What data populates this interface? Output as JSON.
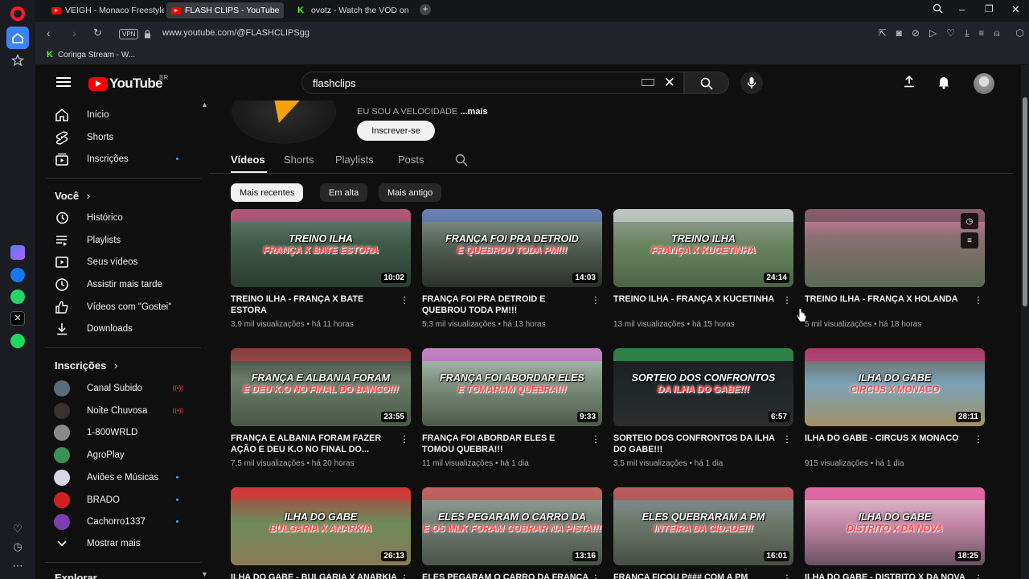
{
  "browser": {
    "tabs": [
      {
        "label": "VEIGH - Monaco Freestyle"
      },
      {
        "label": "FLASH CLIPS - YouTube"
      },
      {
        "label": "ovotz - Watch the VOD on"
      }
    ],
    "url": "www.youtube.com/@FLASHCLIPSgg",
    "vpn_label": "VPN",
    "bookmark": "Coringa Stream - W..."
  },
  "youtube": {
    "logo_text": "YouTube",
    "country_code": "BR",
    "search_value": "flashclips"
  },
  "sidebar": {
    "main": [
      {
        "label": "Início",
        "icon": "home-icon"
      },
      {
        "label": "Shorts",
        "icon": "shorts-icon"
      },
      {
        "label": "Inscrições",
        "icon": "subscriptions-icon"
      }
    ],
    "you_heading": "Você",
    "you": [
      {
        "label": "Histórico",
        "icon": "history-icon"
      },
      {
        "label": "Playlists",
        "icon": "playlists-icon"
      },
      {
        "label": "Seus vídeos",
        "icon": "your-videos-icon"
      },
      {
        "label": "Assistir mais tarde",
        "icon": "watch-later-icon"
      },
      {
        "label": "Vídeos com \"Gostei\"",
        "icon": "liked-icon"
      },
      {
        "label": "Downloads",
        "icon": "download-icon"
      }
    ],
    "subs_heading": "Inscrições",
    "subs": [
      {
        "label": "Canal Subido",
        "color": "#5a6b7a",
        "status": "live"
      },
      {
        "label": "Noite Chuvosa",
        "color": "#3a3030",
        "status": "live"
      },
      {
        "label": "1-800WRLD",
        "color": "#8a8a8a",
        "status": "none"
      },
      {
        "label": "AgroPlay",
        "color": "#3d8f5a",
        "status": "none"
      },
      {
        "label": "Aviões e Músicas",
        "color": "#d7d7e6",
        "status": "dot"
      },
      {
        "label": "BRADO",
        "color": "#d02020",
        "status": "dot"
      },
      {
        "label": "Cachorro1337",
        "color": "#7a3fb0",
        "status": "dot"
      }
    ],
    "show_more": "Mostrar mais",
    "explore": "Explorar"
  },
  "channel": {
    "description": "EU SOU A VELOCIDADE",
    "more": "...mais",
    "subscribe": "Inscrever-se",
    "tabs": [
      "Vídeos",
      "Shorts",
      "Playlists",
      "Posts"
    ],
    "chips": [
      "Mais recentes",
      "Em alta",
      "Mais antigo"
    ]
  },
  "videos": [
    {
      "title": "TREINO ILHA - FRANÇA X BATE ESTORA",
      "meta": "3,9 mil visualizações • há 11 horas",
      "duration": "10:02",
      "overlay": "TREINO ILHA",
      "overlay2": "FRANÇA X BATE ESTORA",
      "bg": "linear-gradient(180deg,#6b7e7a 0%,#3f5a48 45%,#2a3d33 100%)",
      "accent": "#e83a78"
    },
    {
      "title": "FRANÇA FOI PRA DETROID E QUEBROU TODA PM!!!",
      "meta": "5,3 mil visualizações • há 13 horas",
      "duration": "14:03",
      "overlay": "FRANÇA FOI PRA DETROID",
      "overlay2": "E QUEBROU TODA PM!!!",
      "bg": "linear-gradient(180deg,#8b9b93 0%,#505c52 50%,#2b2f2a 100%)",
      "accent": "#4a6fd0"
    },
    {
      "title": "TREINO ILHA - FRANÇA X KUCETINHA",
      "meta": "13 mil visualizações • há 15 horas",
      "duration": "24:14",
      "overlay": "TREINO ILHA",
      "overlay2": "FRANÇA X KUCETINHA",
      "bg": "linear-gradient(180deg,#9aa3a0 0%,#6b8460 45%,#4c6445 100%)",
      "accent": "#e0e0e0"
    },
    {
      "title": "TREINO ILHA - FRANÇA X HOLANDA",
      "meta": "5 mil visualizações • há 18 horas",
      "duration": "",
      "overlay": "",
      "overlay2": "",
      "bg": "linear-gradient(180deg,#e47aa3 0%,#8a6f75 35%,#5c6a52 100%)",
      "accent": "#444"
    },
    {
      "title": "FRANÇA E ALBANIA FORAM FAZER AÇÃO E DEU K.O NO FINAL DO...",
      "meta": "7,5 mil visualizações • há 20 horas",
      "duration": "23:55",
      "overlay": "FRANÇA E ALBANIA FORAM",
      "overlay2": "E DEU K.O NO FINAL DO BANCO!!!",
      "bg": "linear-gradient(180deg,#3a3a3a 0%,#6b7d6a 40%,#4a5947 100%)",
      "accent": "#c84040"
    },
    {
      "title": "FRANÇA FOI ABORDAR ELES E TOMOU QUEBRA!!!",
      "meta": "11 mil visualizações • há 1 dia",
      "duration": "9:33",
      "overlay": "FRANÇA FOI ABORDAR ELES",
      "overlay2": "E TOMARAM QUEBRA!!!",
      "bg": "linear-gradient(180deg,#b7c5bd 0%,#7d8f7e 45%,#4d5a4b 100%)",
      "accent": "#d04ad0"
    },
    {
      "title": "SORTEIO DOS CONFRONTOS DA ILHA DO GABE!!!",
      "meta": "3,5 mil visualizações • há 1 dia",
      "duration": "6:57",
      "overlay": "SORTEIO DOS CONFRONTOS",
      "overlay2": "DA ILHA DO GABE!!!",
      "bg": "linear-gradient(180deg,#1a1d1f 0%,#22282a 60%,#2c2c2c 100%)",
      "accent": "#39d16a"
    },
    {
      "title": "ILHA DO GABE - CIRCUS X MONACO",
      "meta": "915 visualizações • há 1 dia",
      "duration": "28:11",
      "overlay": "ILHA DO GABE",
      "overlay2": "CIRCUS X MONACO",
      "bg": "linear-gradient(180deg,#6a5a4a 0%,#7aa3b8 45%,#a39067 100%)",
      "accent": "#e02080"
    },
    {
      "title": "ILHA DO GABE - BULGARIA X ANARKIA",
      "meta": "",
      "duration": "26:13",
      "overlay": "ILHA DO GABE",
      "overlay2": "BULGARIA X ANARKIA",
      "bg": "linear-gradient(180deg,#b83c3c 0%,#6d8a5a 45%,#8a7a55 100%)",
      "accent": "#e83030"
    },
    {
      "title": "ELES PEGARAM O CARRO DA FRANÇA E OS MLK FORAM COBRAR NA PISTA",
      "meta": "",
      "duration": "13:16",
      "overlay": "ELES PEGARAM O CARRO DA",
      "overlay2": "E OS MLK FORAM COBRAR NA PISTA!!!",
      "bg": "linear-gradient(180deg,#9aa8a0 0%,#6e7a70 50%,#4a5249 100%)",
      "accent": "#e03030"
    },
    {
      "title": "FRANÇA FICOU P### COM A PM",
      "meta": "",
      "duration": "16:01",
      "overlay": "ELES QUEBRARAM A PM",
      "overlay2": "INTEIRA DA CIDADE!!!",
      "bg": "linear-gradient(180deg,#8a949a 0%,#6a7468 50%,#484e46 100%)",
      "accent": "#e03030"
    },
    {
      "title": "ILHA DO GABE - DISTRITO X DA NOVA",
      "meta": "",
      "duration": "18:25",
      "overlay": "ILHA DO GABE",
      "overlay2": "DISTRITO X DA NOVA",
      "bg": "linear-gradient(180deg,#e4c6d6 0%,#c68aa8 45%,#6a5060 100%)",
      "accent": "#e02080"
    }
  ]
}
